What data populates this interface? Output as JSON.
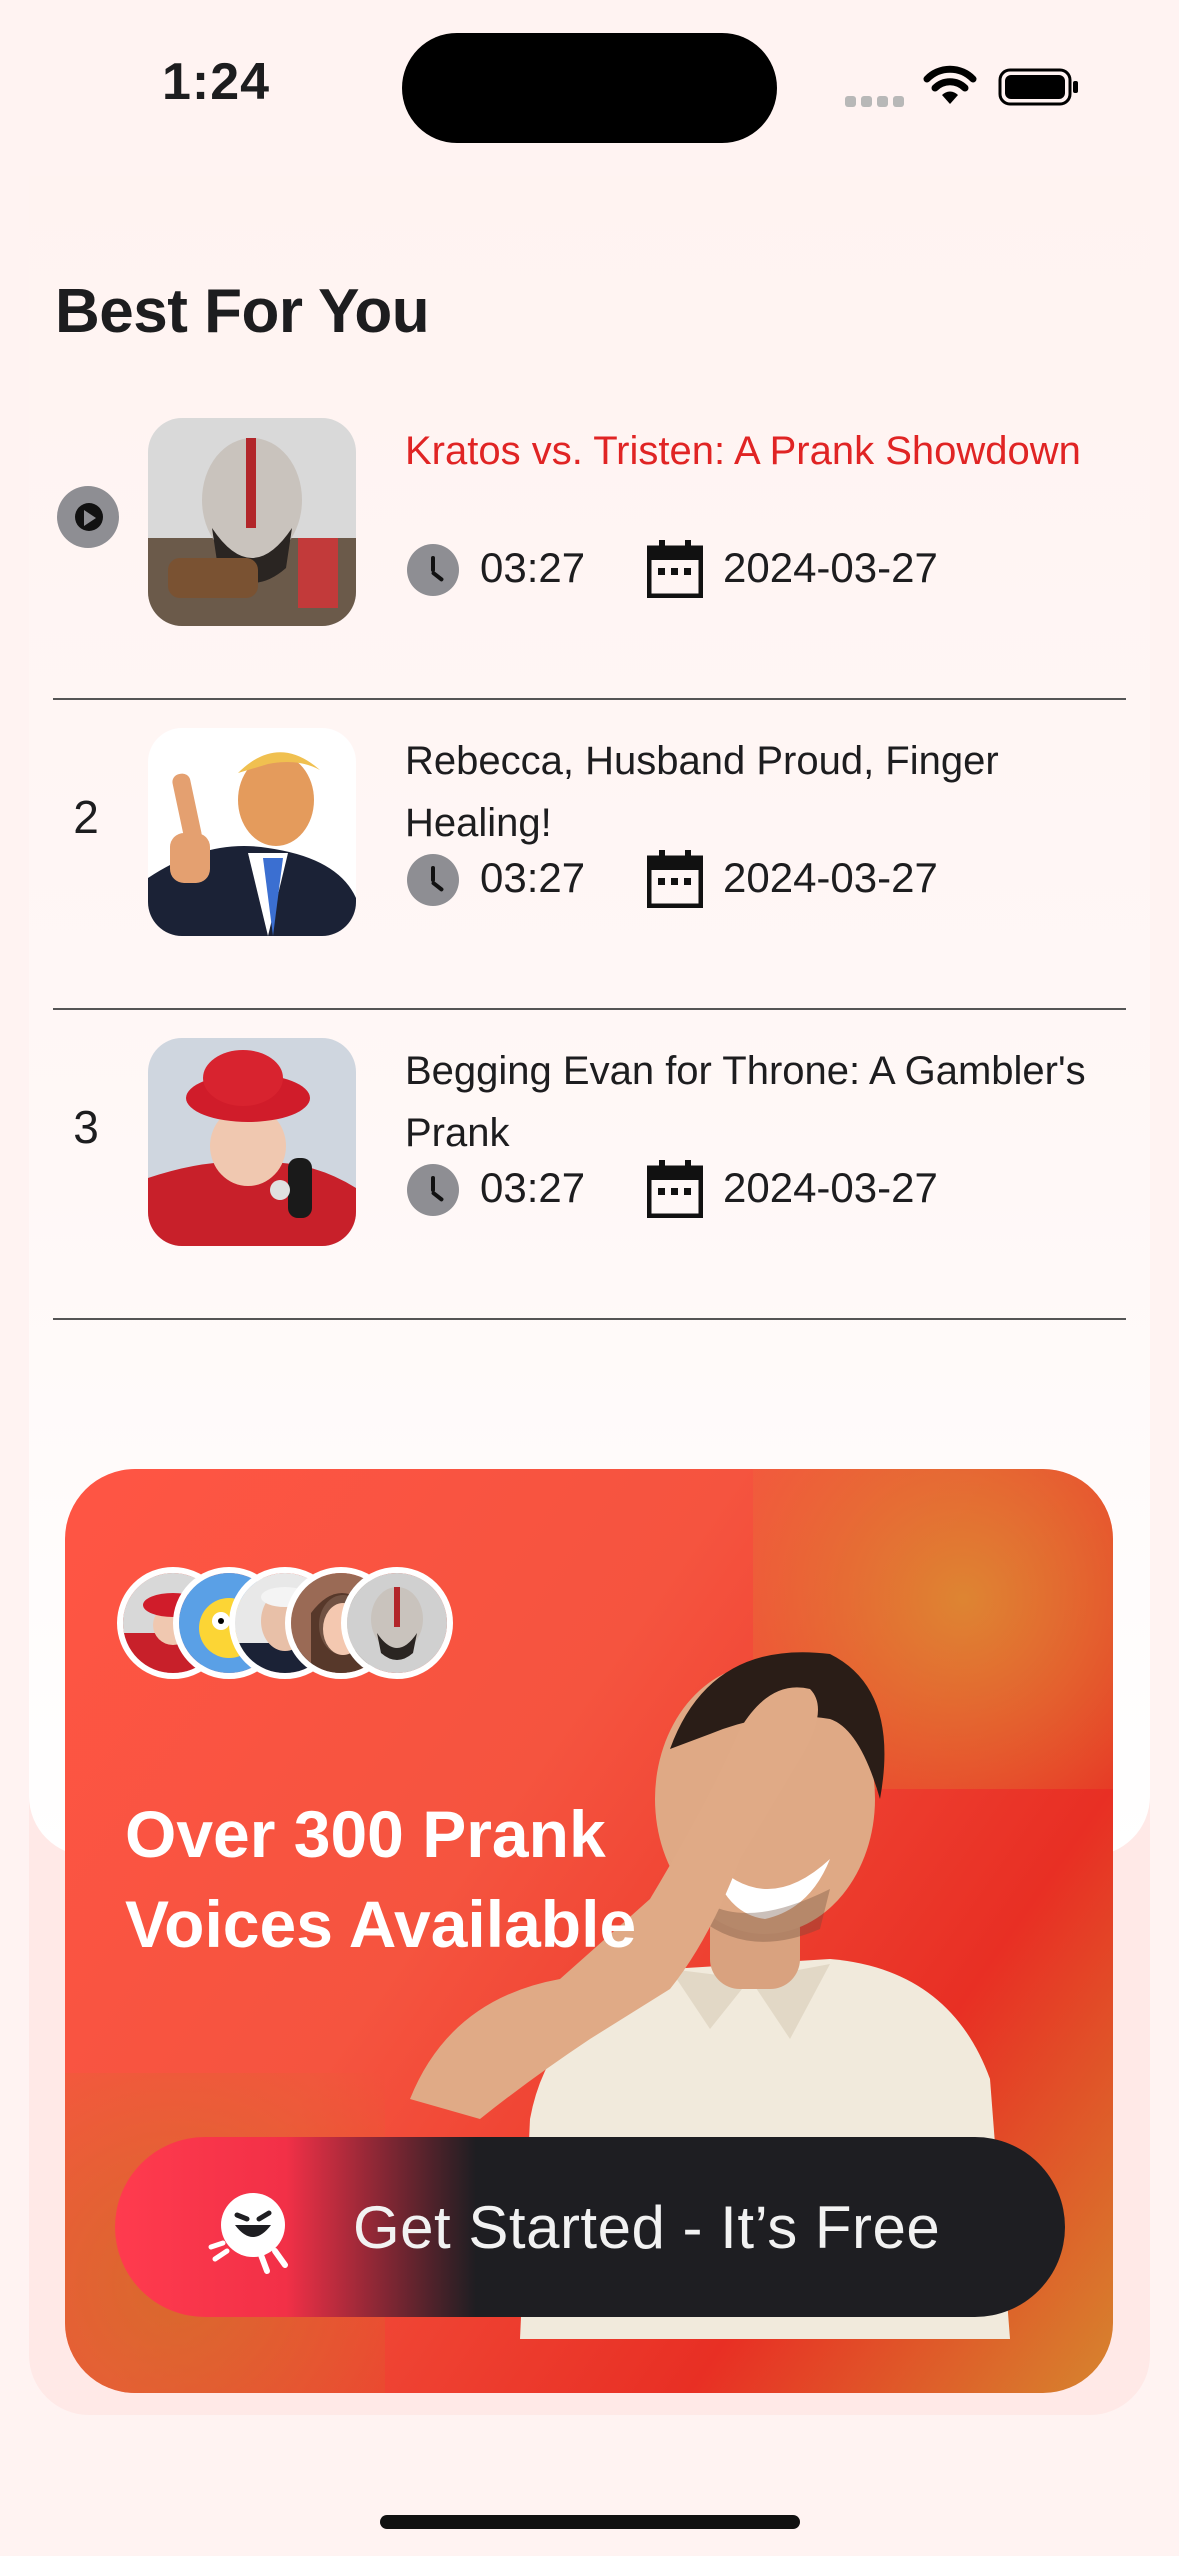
{
  "status_bar": {
    "time": "1:24"
  },
  "section": {
    "title": "Best For You"
  },
  "tracks": [
    {
      "rank": "",
      "title": "Kratos vs. Tristen: A Prank Showdown",
      "duration": "03:27",
      "date": "2024-03-27",
      "playing": true
    },
    {
      "rank": "2",
      "title": "Rebecca, Husband Proud, Finger Healing!",
      "duration": "03:27",
      "date": "2024-03-27",
      "playing": false
    },
    {
      "rank": "3",
      "title": "Begging Evan for Throne: A Gambler's Prank",
      "duration": "03:27",
      "date": "2024-03-27",
      "playing": false
    }
  ],
  "promo": {
    "headline": "Over 300 Prank Voices Available",
    "cta_label": "Get Started - It’s Free"
  },
  "colors": {
    "accent": "#e02424",
    "background": "#fff3f2",
    "cta_dark": "#1e1e22"
  },
  "icons": {
    "play": "play-circle-icon",
    "duration": "clock-icon",
    "date": "calendar-icon",
    "cta": "laughing-face-icon"
  }
}
